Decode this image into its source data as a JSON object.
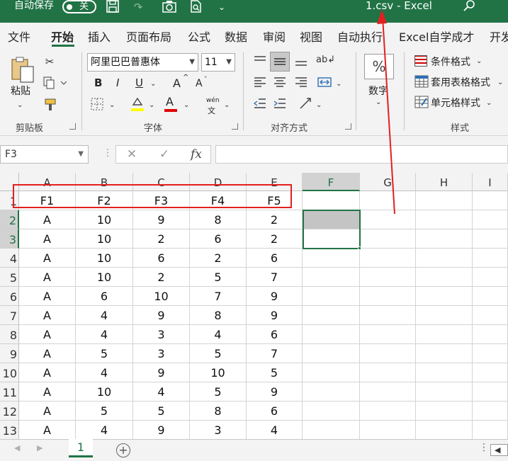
{
  "titlebar": {
    "autosave_label": "自动保存",
    "autosave_state": "关",
    "window_title": "1.csv  -  Excel",
    "accent_color": "#217346"
  },
  "quick_access": {
    "icons": [
      "save-icon",
      "redo-icon",
      "camera-icon",
      "print-preview-icon",
      "customize-icon"
    ]
  },
  "tabs": [
    "文件",
    "开始",
    "插入",
    "页面布局",
    "公式",
    "数据",
    "审阅",
    "视图",
    "自动执行",
    "Excel自学成才",
    "开发"
  ],
  "active_tab": "开始",
  "ribbon": {
    "clipboard": {
      "paste_label": "粘贴",
      "group_label": "剪贴板"
    },
    "font": {
      "font_name": "阿里巴巴普惠体",
      "font_size": "11",
      "group_label": "字体",
      "bold": "B",
      "italic": "I",
      "underline": "U",
      "grow": "A",
      "shrink": "A",
      "font_color_letter": "A",
      "phonetic_top": "wén",
      "phonetic_bottom": "文"
    },
    "alignment": {
      "group_label": "对齐方式"
    },
    "number": {
      "label": "数字",
      "symbol": "%"
    },
    "styles": {
      "group_label": "样式",
      "conditional": "条件格式",
      "table": "套用表格格式",
      "cell_styles": "单元格样式"
    }
  },
  "formula_bar": {
    "name_box": "F3",
    "fx": "fx",
    "cancel": "✕",
    "enter": "✓",
    "content": ""
  },
  "grid": {
    "columns": [
      "A",
      "B",
      "C",
      "D",
      "E",
      "F",
      "G",
      "H",
      "I"
    ],
    "selected_column": "F",
    "selected_rows": [
      "2",
      "3"
    ],
    "row_numbers": [
      "1",
      "2",
      "3",
      "4",
      "5",
      "6",
      "7",
      "8",
      "9",
      "10",
      "11",
      "12",
      "13"
    ],
    "rows": [
      [
        "F1",
        "F2",
        "F3",
        "F4",
        "F5"
      ],
      [
        "A",
        "10",
        "9",
        "8",
        "2"
      ],
      [
        "A",
        "10",
        "2",
        "6",
        "2"
      ],
      [
        "A",
        "10",
        "6",
        "2",
        "6"
      ],
      [
        "A",
        "10",
        "2",
        "5",
        "7"
      ],
      [
        "A",
        "6",
        "10",
        "7",
        "9"
      ],
      [
        "A",
        "4",
        "9",
        "8",
        "9"
      ],
      [
        "A",
        "4",
        "3",
        "4",
        "6"
      ],
      [
        "A",
        "5",
        "3",
        "5",
        "7"
      ],
      [
        "A",
        "4",
        "9",
        "10",
        "5"
      ],
      [
        "A",
        "10",
        "4",
        "5",
        "9"
      ],
      [
        "A",
        "5",
        "5",
        "8",
        "6"
      ],
      [
        "A",
        "4",
        "9",
        "3",
        "4"
      ]
    ]
  },
  "sheets": {
    "tabs": [
      "1"
    ],
    "active": "1",
    "add_label": "+"
  },
  "annotation_color": "#e32020"
}
